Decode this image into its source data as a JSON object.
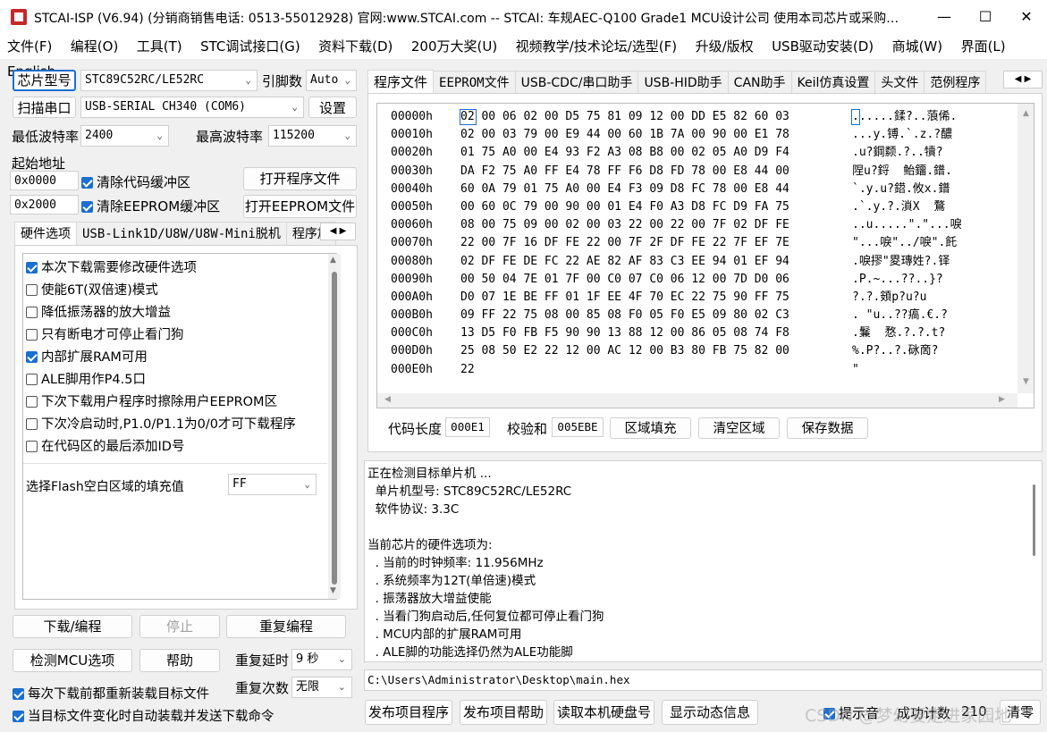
{
  "window": {
    "title": "STCAI-ISP (V6.94) (分销商销售电话: 0513-55012928) 官网:www.STCAI.com  -- STCAI: 车规AEC-Q100 Grade1 MCU设计公司 使用本司芯片或采购…",
    "minimize": "—",
    "maximize": "☐",
    "close": "✕"
  },
  "menu": [
    "文件(F)",
    "编程(O)",
    "工具(T)",
    "STC调试接口(G)",
    "资料下载(D)",
    "200万大奖(U)",
    "视频教学/技术论坛/选型(F)",
    "升级/版权",
    "USB驱动安装(D)",
    "商城(W)",
    "界面(L)",
    "English"
  ],
  "left": {
    "chip_type_button": "芯片型号",
    "chip_type_value": "STC89C52RC/LE52RC",
    "pin_count_label": "引脚数",
    "pin_count_value": "Auto",
    "scan_port_button": "扫描串口",
    "port_value": "USB-SERIAL CH340 (COM6)",
    "settings_button": "设置",
    "min_baud_label": "最低波特率",
    "min_baud_value": "2400",
    "max_baud_label": "最高波特率",
    "max_baud_value": "115200",
    "start_addr_label": "起始地址",
    "code_addr": "0x0000",
    "clear_code_label": "清除代码缓冲区",
    "open_program_button": "打开程序文件",
    "eeprom_addr": "0x2000",
    "clear_eeprom_label": "清除EEPROM缓冲区",
    "open_eeprom_button": "打开EEPROM文件",
    "tabs": [
      "硬件选项",
      "USB-Link1D/U8W/U8W-Mini脱机",
      "程序加"
    ],
    "options": [
      {
        "label": "本次下载需要修改硬件选项",
        "checked": true
      },
      {
        "label": "使能6T(双倍速)模式",
        "checked": false
      },
      {
        "label": "降低振荡器的放大增益",
        "checked": false
      },
      {
        "label": "只有断电才可停止看门狗",
        "checked": false
      },
      {
        "label": "内部扩展RAM可用",
        "checked": true
      },
      {
        "label": "ALE脚用作P4.5口",
        "checked": false
      },
      {
        "label": "下次下载用户程序时擦除用户EEPROM区",
        "checked": false
      },
      {
        "label": "下次冷启动时,P1.0/P1.1为0/0才可下载程序",
        "checked": false
      },
      {
        "label": "在代码区的最后添加ID号",
        "checked": false
      }
    ],
    "fill_label": "选择Flash空白区域的填充值",
    "fill_value": "FF",
    "download_button": "下载/编程",
    "stop_button": "停止",
    "repeat_button": "重复编程",
    "check_mcu_button": "检测MCU选项",
    "help_button": "帮助",
    "repeat_delay_label": "重复延时",
    "repeat_delay_value": "9 秒",
    "repeat_count_label": "重复次数",
    "repeat_count_value": "无限",
    "reload_label": "每次下载前都重新装载目标文件",
    "auto_load_label": "当目标文件变化时自动装载并发送下载命令"
  },
  "right": {
    "tabs": [
      "程序文件",
      "EEPROM文件",
      "USB-CDC/串口助手",
      "USB-HID助手",
      "CAN助手",
      "Keil仿真设置",
      "头文件",
      "范例程序"
    ],
    "hex_rows": [
      {
        "addr": "00000h",
        "bytes": "02 00 06 02 00 D5 75 81 09 12 00 DD E5 82 60 03",
        "ascii": "......鍒?..蒗俙."
      },
      {
        "addr": "00010h",
        "bytes": "02 00 03 79 00 E9 44 00 60 1B 7A 00 90 00 E1 78",
        "ascii": "...y.镈.`.z.?醲"
      },
      {
        "addr": "00020h",
        "bytes": "01 75 A0 00 E4 93 F2 A3 08 B8 00 02 05 A0 D9 F4",
        "ascii": ".u?鋼颣.?..犢?"
      },
      {
        "addr": "00030h",
        "bytes": "DA F2 75 A0 FF E4 78 FF F6 D8 FD 78 00 E8 44 00",
        "ascii": "陧u?鋝  鲐鐂.鐠."
      },
      {
        "addr": "00040h",
        "bytes": "60 0A 79 01 75 A0 00 E4 F3 09 D8 FC 78 00 E8 44",
        "ascii": "`.y.u?鍣.攸x.鐠"
      },
      {
        "addr": "00050h",
        "bytes": "00 60 0C 79 00 90 00 01 E4 F0 A3 D8 FC D9 FA 75",
        "ascii": ".`.y.?.溑X  鶩"
      },
      {
        "addr": "00060h",
        "bytes": "08 00 75 09 00 02 00 03 22 00 22 00 7F 02 DF FE",
        "ascii": "..u.....\".\"...唳"
      },
      {
        "addr": "00070h",
        "bytes": "22 00 7F 16 DF FE 22 00 7F 2F DF FE 22 7F EF 7E",
        "ascii": "\"...唳\"../唳\".飥"
      },
      {
        "addr": "00080h",
        "bytes": "02 DF FE DE FC 22 AE 82 AF 83 C3 EE 94 01 EF 94",
        "ascii": ".唳摎\"畟瑼姓?.铎"
      },
      {
        "addr": "00090h",
        "bytes": "00 50 04 7E 01 7F 00 C0 07 C0 06 12 00 7D D0 06",
        "ascii": ".P.~...??..}?"
      },
      {
        "addr": "000A0h",
        "bytes": "D0 07 1E BE FF 01 1F EE 4F 70 EC 22 75 90 FF 75",
        "ascii": "?.?.頞p?u?u"
      },
      {
        "addr": "000B0h",
        "bytes": "09 FF 22 75 08 00 85 08 F0 05 F0 E5 09 80 02 C3",
        "ascii": ". \"u..??瘑.€.?"
      },
      {
        "addr": "000C0h",
        "bytes": "13 D5 F0 FB F5 90 90 13 88 12 00 86 05 08 74 F8",
        "ascii": ".鬑  愗.?.?.t?"
      },
      {
        "addr": "000D0h",
        "bytes": "25 08 50 E2 22 12 00 AC 12 00 B3 80 FB 75 82 00",
        "ascii": "%.P?..?.砯啇?"
      },
      {
        "addr": "000E0h",
        "bytes": "22",
        "ascii": "\""
      }
    ],
    "code_length_label": "代码长度",
    "code_length_value": "000E1",
    "checksum_label": "校验和",
    "checksum_value": "005EBE",
    "fill_area_button": "区域填充",
    "clear_area_button": "清空区域",
    "save_data_button": "保存数据",
    "log": [
      "正在检测目标单片机 ...",
      "  单片机型号: STC89C52RC/LE52RC",
      "  软件协议: 3.3C",
      "",
      "当前芯片的硬件选项为:",
      "  . 当前的时钟频率: 11.956MHz",
      "  . 系统频率为12T(单倍速)模式",
      "  . 振荡器放大增益使能",
      "  . 当看门狗启动后,任何复位都可停止看门狗",
      "  . MCU内部的扩展RAM可用",
      "  . ALE脚的功能选择仍然为ALE功能脚"
    ],
    "file_path": "C:\\Users\\Administrator\\Desktop\\main.hex",
    "publish_program_button": "发布项目程序",
    "publish_help_button": "发布项目帮助",
    "read_disk_button": "读取本机硬盘号",
    "dynamic_info_button": "显示动态信息",
    "sound_label": "提示音",
    "success_count_label": "成功计数",
    "success_count_value": "210",
    "clear_button": "清零",
    "watermark": "CSDN @梦幻要走进家园地"
  }
}
